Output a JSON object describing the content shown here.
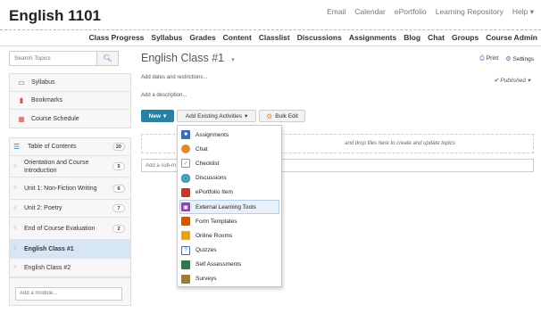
{
  "header": {
    "course_title": "English 1101",
    "links": [
      "Email",
      "Calendar",
      "ePortfolio",
      "Learning Repository",
      "Help ▾"
    ]
  },
  "nav": {
    "items": [
      "Class Progress",
      "Syllabus",
      "Grades",
      "Content",
      "Classlist",
      "Discussions",
      "Assignments",
      "Blog",
      "Chat",
      "Groups",
      "Course Admin"
    ]
  },
  "sidebar": {
    "search_placeholder": "Search Topics",
    "links": [
      {
        "label": "Syllabus",
        "icon": "page-icon"
      },
      {
        "label": "Bookmarks",
        "icon": "bookmark-icon"
      },
      {
        "label": "Course Schedule",
        "icon": "calendar-icon"
      }
    ],
    "toc": {
      "label": "Table of Contents",
      "count": "20"
    },
    "modules": [
      {
        "label": "Orientation and Course Introduction",
        "count": "5"
      },
      {
        "label": "Unit 1: Non-Fiction Writing",
        "count": "6"
      },
      {
        "label": "Unit 2: Poetry",
        "count": "7"
      },
      {
        "label": "End of Course Evaluation",
        "count": "2"
      },
      {
        "label": "English Class #1",
        "count": ""
      },
      {
        "label": "English Class #2",
        "count": ""
      }
    ],
    "add_module_placeholder": "Add a module..."
  },
  "main": {
    "title": "English Class #1",
    "print_label": "Print",
    "settings_label": "Settings",
    "add_dates": "Add dates and restrictions...",
    "published": "Published",
    "add_description": "Add a description...",
    "new_label": "New",
    "add_existing_label": "Add Existing Activities",
    "bulk_edit_label": "Bulk Edit",
    "dropzone_text": "and drop files here to create and update topics",
    "sub_module_placeholder": "Add a sub-m"
  },
  "dropdown": {
    "items": [
      {
        "label": "Assignments",
        "icon": "assignments-icon",
        "color": "#3b6db3"
      },
      {
        "label": "Chat",
        "icon": "chat-icon",
        "color": "#e08a2e"
      },
      {
        "label": "Checklist",
        "icon": "checklist-icon",
        "color": "#6a9c3a"
      },
      {
        "label": "Discussions",
        "icon": "discussions-icon",
        "color": "#4aa0b8"
      },
      {
        "label": "ePortfolio Item",
        "icon": "eportfolio-icon",
        "color": "#c0392b"
      },
      {
        "label": "External Learning Tools",
        "icon": "external-tools-icon",
        "color": "#8e44ad"
      },
      {
        "label": "Form Templates",
        "icon": "form-templates-icon",
        "color": "#d35400"
      },
      {
        "label": "Online Rooms",
        "icon": "online-rooms-icon",
        "color": "#e5a21a"
      },
      {
        "label": "Quizzes",
        "icon": "quizzes-icon",
        "color": "#3b6db3"
      },
      {
        "label": "Self Assessments",
        "icon": "self-assessments-icon",
        "color": "#2c7a4b"
      },
      {
        "label": "Surveys",
        "icon": "surveys-icon",
        "color": "#9b7a3a"
      }
    ],
    "highlighted_index": 5
  },
  "colors": {
    "accent": "#2a7fa4",
    "active_row": "#d6e6f5",
    "header_dash": "#e8b24a"
  }
}
